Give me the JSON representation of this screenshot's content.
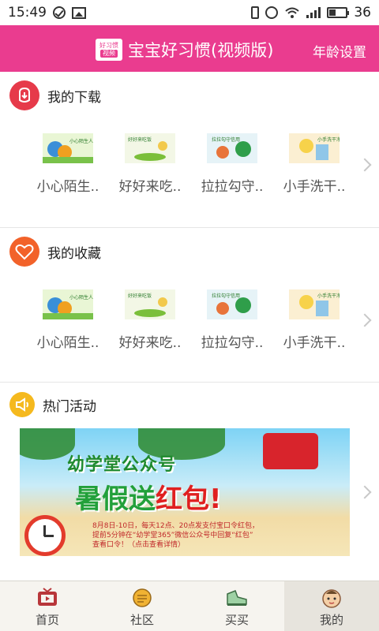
{
  "status_bar": {
    "time": "15:49",
    "battery": "36"
  },
  "header": {
    "logo_line1": "好习惯",
    "logo_line2": "视频",
    "title": "宝宝好习惯(视频版)",
    "age_setting": "年龄设置"
  },
  "downloads": {
    "title": "我的下载",
    "items": [
      {
        "label": "小心陌生..",
        "thumb_caption": "小心陌生人"
      },
      {
        "label": "好好来吃..",
        "thumb_caption": "好好来吃饭"
      },
      {
        "label": "拉拉勾守..",
        "thumb_caption": "拉拉勾守信用"
      },
      {
        "label": "小手洗干..",
        "thumb_caption": "小手洗干净"
      }
    ]
  },
  "favorites": {
    "title": "我的收藏",
    "items": [
      {
        "label": "小心陌生..",
        "thumb_caption": "小心陌生人"
      },
      {
        "label": "好好来吃..",
        "thumb_caption": "好好来吃饭"
      },
      {
        "label": "拉拉勾守..",
        "thumb_caption": "拉拉勾守信用"
      },
      {
        "label": "小手洗干..",
        "thumb_caption": "小手洗干净"
      }
    ]
  },
  "activities": {
    "title": "热门活动",
    "banner": {
      "line1": "幼学堂公众号",
      "line2_a": "暑假送",
      "line2_b": "红包!",
      "detail_1": "8月8日-10日，每天12点、20点发支付宝口令红包，",
      "detail_2": "提前5分钟在“幼学堂365”微信公众号中回复“红包”",
      "detail_3": "查看口令！（点击查看详情）"
    }
  },
  "tabbar": {
    "tabs": [
      {
        "label": "首页",
        "icon": "tv-icon",
        "active": false
      },
      {
        "label": "社区",
        "icon": "chat-icon",
        "active": false
      },
      {
        "label": "买买",
        "icon": "shoe-icon",
        "active": false
      },
      {
        "label": "我的",
        "icon": "baby-face-icon",
        "active": true
      }
    ]
  },
  "colors": {
    "header": "#ea3c8f",
    "download_icon": "#e63a4a",
    "favorite_icon": "#f2622a",
    "activity_icon": "#f5b91e"
  }
}
